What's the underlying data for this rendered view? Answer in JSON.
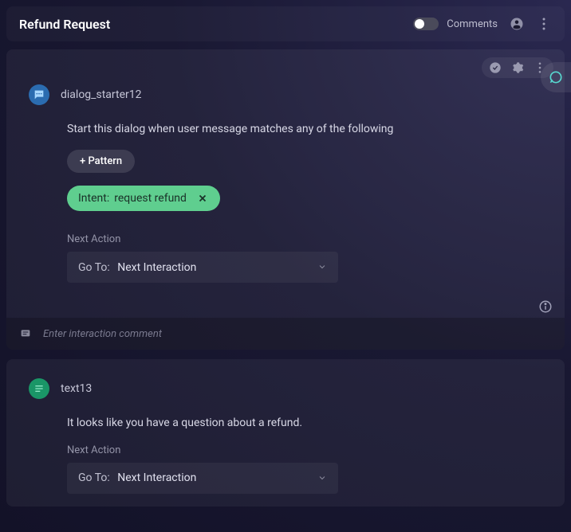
{
  "header": {
    "title": "Refund Request",
    "comments_label": "Comments"
  },
  "nodes": [
    {
      "name": "dialog_starter12",
      "description": "Start this dialog when user message matches any of the following",
      "add_pattern_label": "+ Pattern",
      "intent": {
        "prefix": "Intent:",
        "value": "request refund"
      },
      "next_action_label": "Next Action",
      "goto_prefix": "Go To:",
      "goto_value": "Next Interaction",
      "comment_placeholder": "Enter interaction comment"
    },
    {
      "name": "text13",
      "description": "It looks like you have a question about a refund.",
      "next_action_label": "Next Action",
      "goto_prefix": "Go To:",
      "goto_value": "Next Interaction"
    }
  ]
}
